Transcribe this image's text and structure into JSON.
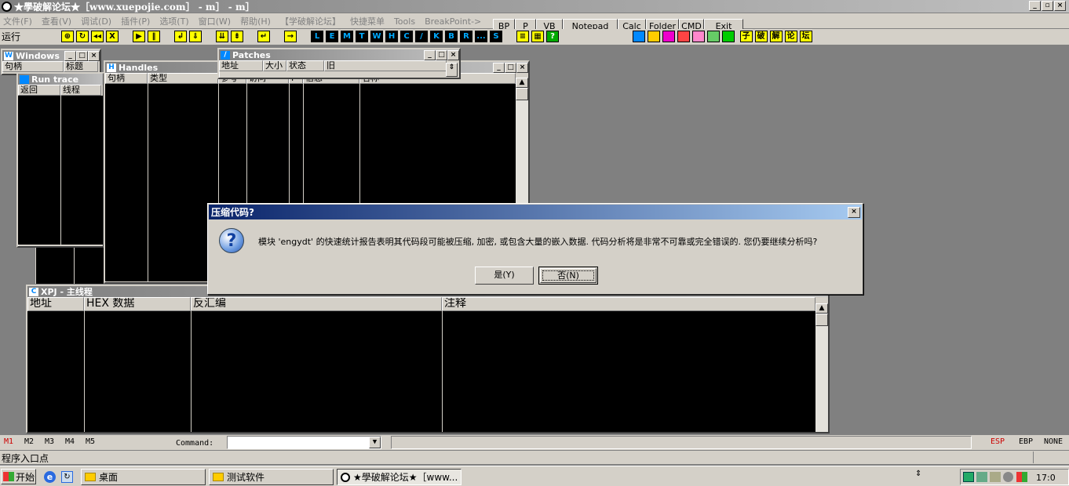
{
  "app": {
    "title": "★學破解论坛★［www.xuepojie.com］ - m］ - m］"
  },
  "menu": [
    "文件(F)",
    "查看(V)",
    "调试(D)",
    "插件(P)",
    "选项(T)",
    "窗口(W)",
    "帮助(H)",
    "【学破解论坛】",
    "快捷菜单",
    "Tools",
    "BreakPoint->"
  ],
  "quick": [
    "BP",
    "P",
    "VB",
    "Notepad",
    "Calc",
    "Folder",
    "CMD",
    "Exit"
  ],
  "toolbar": {
    "status": "运行",
    "letters": [
      "L",
      "E",
      "M",
      "T",
      "W",
      "H",
      "C",
      "/",
      "K",
      "B",
      "R",
      "...",
      "S"
    ],
    "right_letters": [
      "子",
      "破",
      "解",
      "论",
      "坛"
    ]
  },
  "windows_win": {
    "title": "Windows",
    "cols": [
      "句柄",
      "标题"
    ]
  },
  "runtrace": {
    "title": "Run trace",
    "cols": [
      "返回",
      "线程"
    ]
  },
  "handles": {
    "title": "Handles",
    "cols": [
      "句柄",
      "类型",
      "参考",
      "访问",
      "I",
      "信息",
      "名称"
    ]
  },
  "patches": {
    "title": "Patches",
    "cols": [
      "地址",
      "大小",
      "状态",
      "旧"
    ]
  },
  "cpu": {
    "title": "XPJ - 主线程",
    "cols": [
      "地址",
      "HEX 数据",
      "反汇编",
      "注释"
    ]
  },
  "dialog": {
    "title": "压缩代码?",
    "message": "模块 'engydt' 的快速统计报告表明其代码段可能被压缩, 加密, 或包含大量的嵌入数据. 代码分析将是非常不可靠或完全错误的. 您仍要继续分析吗?",
    "yes": "是(Y)",
    "no": "否(N)"
  },
  "status": {
    "tabs": [
      "M1",
      "M2",
      "M3",
      "M4",
      "M5"
    ],
    "command_label": "Command:",
    "regs": [
      "ESP",
      "EBP",
      "NONE"
    ],
    "entry": "程序入口点"
  },
  "taskbar": {
    "start": "开始",
    "items": [
      "桌面",
      "测试软件",
      "★學破解论坛★［www..."
    ],
    "clock": "17:0"
  },
  "colors": {
    "titlebar": "#0a246a",
    "bg": "#808080",
    "face": "#d4d0c8",
    "reg_active": "#c00000"
  }
}
